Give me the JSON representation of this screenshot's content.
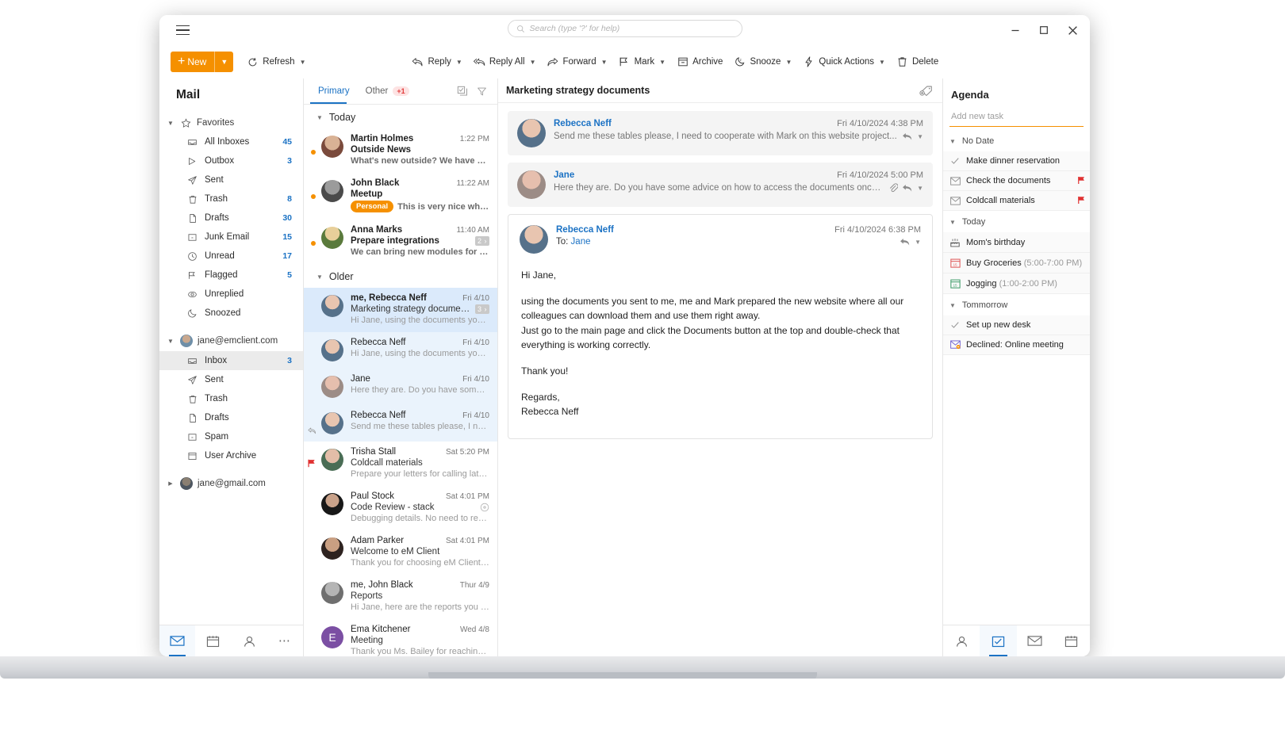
{
  "window": {
    "search_placeholder": "Search (type '?' for help)",
    "controls": {
      "minimize": "minimize-icon",
      "maximize": "maximize-icon",
      "close": "close-icon"
    },
    "menu_icon": "hamburger-icon"
  },
  "toolbar": {
    "new_label": "New",
    "refresh_label": "Refresh",
    "items": [
      {
        "label": "Reply",
        "icon": "reply-icon",
        "caret": true
      },
      {
        "label": "Reply All",
        "icon": "reply-all-icon",
        "caret": true
      },
      {
        "label": "Forward",
        "icon": "forward-icon",
        "caret": true
      },
      {
        "label": "Mark",
        "icon": "flag-icon",
        "caret": true
      },
      {
        "label": "Archive",
        "icon": "archive-icon",
        "caret": false
      },
      {
        "label": "Snooze",
        "icon": "snooze-icon",
        "caret": true
      },
      {
        "label": "Quick Actions",
        "icon": "lightning-icon",
        "caret": true
      },
      {
        "label": "Delete",
        "icon": "trash-icon",
        "caret": false
      }
    ]
  },
  "sidebar": {
    "title": "Mail",
    "favorites_label": "Favorites",
    "favorites": [
      {
        "label": "All Inboxes",
        "count": "45",
        "icon": "inbox-icon"
      },
      {
        "label": "Outbox",
        "count": "3",
        "icon": "outbox-icon"
      },
      {
        "label": "Sent",
        "count": "",
        "icon": "sent-icon"
      },
      {
        "label": "Trash",
        "count": "8",
        "icon": "trash-icon"
      },
      {
        "label": "Drafts",
        "count": "30",
        "icon": "drafts-icon"
      },
      {
        "label": "Junk Email",
        "count": "15",
        "icon": "junk-icon"
      },
      {
        "label": "Unread",
        "count": "17",
        "icon": "clock-icon"
      },
      {
        "label": "Flagged",
        "count": "5",
        "icon": "flag-icon"
      },
      {
        "label": "Unreplied",
        "count": "",
        "icon": "eye-icon"
      },
      {
        "label": "Snoozed",
        "count": "",
        "icon": "snooze-icon"
      }
    ],
    "account1": {
      "label": "jane@emclient.com",
      "expanded": true
    },
    "account1_folders": [
      {
        "label": "Inbox",
        "count": "3",
        "icon": "inbox-icon",
        "selected": true
      },
      {
        "label": "Sent",
        "count": "",
        "icon": "sent-icon",
        "selected": false
      },
      {
        "label": "Trash",
        "count": "",
        "icon": "trash-icon",
        "selected": false
      },
      {
        "label": "Drafts",
        "count": "",
        "icon": "drafts-icon",
        "selected": false
      },
      {
        "label": "Spam",
        "count": "",
        "icon": "junk-icon",
        "selected": false
      },
      {
        "label": "User Archive",
        "count": "",
        "icon": "archive-icon",
        "selected": false
      }
    ],
    "account2": {
      "label": "jane@gmail.com",
      "expanded": false
    },
    "bottom_nav": [
      {
        "icon": "mail-icon",
        "active": true
      },
      {
        "icon": "calendar-icon",
        "active": false
      },
      {
        "icon": "contacts-icon",
        "active": false
      },
      {
        "icon": "more-icon",
        "active": false
      }
    ]
  },
  "messagelist": {
    "tabs": [
      {
        "label": "Primary",
        "badge": "",
        "active": true
      },
      {
        "label": "Other",
        "badge": "+1",
        "active": false
      }
    ],
    "header_icons": [
      {
        "icon": "select-all-icon"
      },
      {
        "icon": "filter-icon"
      }
    ],
    "sections": [
      {
        "label": "Today",
        "messages": [
          {
            "from": "Martin Holmes",
            "time": "1:22 PM",
            "subject": "Outside News",
            "preview": "What's new outside? We have been...",
            "unread": true,
            "selected": false,
            "thread": false,
            "category": "",
            "count": "",
            "avatar_color": "#8d6e5a",
            "avatar_letter": "",
            "flagged": false,
            "replied": false,
            "attachment": false,
            "snoozed": false
          },
          {
            "from": "John Black",
            "time": "11:22 AM",
            "subject": "Meetup",
            "preview": "This is very nice when y...",
            "unread": true,
            "selected": false,
            "thread": false,
            "category": "Personal",
            "count": "",
            "avatar_color": "#6b6b6b",
            "avatar_letter": "",
            "flagged": false,
            "replied": false,
            "attachment": false,
            "snoozed": false
          },
          {
            "from": "Anna Marks",
            "time": "11:40 AM",
            "subject": "Prepare integrations",
            "preview": "We can bring new modules for you...",
            "unread": true,
            "selected": false,
            "thread": false,
            "category": "",
            "count": "2 ›",
            "avatar_color": "#b59a6a",
            "avatar_letter": "",
            "flagged": false,
            "replied": false,
            "attachment": false,
            "snoozed": false
          }
        ]
      },
      {
        "label": "Older",
        "messages": [
          {
            "from": "me, Rebecca Neff",
            "time": "Fri 4/10",
            "subject": "Marketing strategy documents",
            "preview": "Hi Jane, using the documents you se...",
            "unread": false,
            "selected": true,
            "thread": false,
            "category": "",
            "count": "3 ›",
            "avatar_color": "#7e6a78",
            "avatar_letter": "",
            "flagged": false,
            "replied": false,
            "attachment": false,
            "snoozed": false
          },
          {
            "from": "Rebecca Neff",
            "time": "Fri 4/10",
            "subject": "",
            "preview": "Hi Jane, using the documents you se...",
            "unread": false,
            "selected": false,
            "thread": true,
            "category": "",
            "count": "",
            "avatar_color": "#7e6a78",
            "avatar_letter": "",
            "flagged": false,
            "replied": false,
            "attachment": false,
            "snoozed": false
          },
          {
            "from": "Jane",
            "time": "Fri 4/10",
            "subject": "",
            "preview": "Here they are. Do you have some adv...",
            "unread": false,
            "selected": false,
            "thread": true,
            "category": "",
            "count": "",
            "avatar_color": "#9a7f74",
            "avatar_letter": "",
            "flagged": false,
            "replied": false,
            "attachment": false,
            "snoozed": false
          },
          {
            "from": "Rebecca Neff",
            "time": "Fri 4/10",
            "subject": "",
            "preview": "Send me these tables please, I need t...",
            "unread": false,
            "selected": false,
            "thread": true,
            "category": "",
            "count": "",
            "avatar_color": "#7e6a78",
            "avatar_letter": "",
            "flagged": false,
            "replied": true,
            "attachment": false,
            "snoozed": false
          },
          {
            "from": "Trisha Stall",
            "time": "Sat 5:20 PM",
            "subject": "Coldcall materials",
            "preview": "Prepare your letters for calling later t...",
            "unread": false,
            "selected": false,
            "thread": false,
            "category": "",
            "count": "",
            "avatar_color": "#6f8a6f",
            "avatar_letter": "",
            "flagged": true,
            "replied": false,
            "attachment": false,
            "snoozed": false
          },
          {
            "from": "Paul Stock",
            "time": "Sat 4:01 PM",
            "subject": "Code Review - stack",
            "preview": "Debugging details. No need to reply.",
            "unread": false,
            "selected": false,
            "thread": false,
            "category": "",
            "count": "",
            "avatar_color": "#3d3a38",
            "avatar_letter": "",
            "flagged": false,
            "replied": false,
            "attachment": false,
            "snoozed": true
          },
          {
            "from": "Adam Parker",
            "time": "Sat 4:01 PM",
            "subject": "Welcome to eM Client",
            "preview": "Thank you for choosing eM Client. It...",
            "unread": false,
            "selected": false,
            "thread": false,
            "category": "",
            "count": "",
            "avatar_color": "#4a3b2f",
            "avatar_letter": "",
            "flagged": false,
            "replied": false,
            "attachment": false,
            "snoozed": false
          },
          {
            "from": "me, John Black",
            "time": "Thur 4/9",
            "subject": "Reports",
            "preview": "Hi Jane, here are the reports you ask...",
            "unread": false,
            "selected": false,
            "thread": false,
            "category": "",
            "count": "",
            "avatar_color": "#8d8d8d",
            "avatar_letter": "",
            "flagged": false,
            "replied": false,
            "attachment": false,
            "snoozed": false
          },
          {
            "from": "Ema Kitchener",
            "time": "Wed 4/8",
            "subject": "Meeting",
            "preview": "Thank you Ms. Bailey for reaching ou...",
            "unread": false,
            "selected": false,
            "thread": false,
            "category": "",
            "count": "",
            "avatar_color": "#7b4fa3",
            "avatar_letter": "E",
            "flagged": false,
            "replied": false,
            "attachment": false,
            "snoozed": false
          }
        ]
      }
    ]
  },
  "reader": {
    "title": "Marketing strategy documents",
    "tag_icon": "add-tag-icon",
    "collapsed": [
      {
        "name": "Rebecca Neff",
        "date": "Fri 4/10/2024 4:38 PM",
        "preview": "Send me these tables please, I need to cooperate with Mark on this website project...",
        "attachment": false,
        "avatar_color": "#7e6a78"
      },
      {
        "name": "Jane",
        "date": "Fri 4/10/2024 5:00 PM",
        "preview": "Here they are. Do you have some advice on how to access the documents once th...",
        "attachment": true,
        "avatar_color": "#9a7f74"
      }
    ],
    "open": {
      "name": "Rebecca Neff",
      "date": "Fri 4/10/2024 6:38 PM",
      "to_label": "To:",
      "to_name": "Jane",
      "avatar_color": "#7e6a78",
      "paragraphs": [
        "Hi Jane,",
        "using the documents you sent to me, me and Mark prepared the new website where all our colleagues can download them and use them right away.\nJust go to the main page and click the Documents button at the top and double-check that everything is working correctly.",
        "Thank you!",
        "Regards,\nRebecca Neff"
      ]
    }
  },
  "agenda": {
    "title": "Agenda",
    "add_task_placeholder": "Add new task",
    "groups": [
      {
        "label": "No Date",
        "items": [
          {
            "text": "Make dinner reservation",
            "time": "",
            "icon": "check-icon",
            "flagged": false
          },
          {
            "text": "Check the documents",
            "time": "",
            "icon": "mail-task-icon",
            "flagged": true
          },
          {
            "text": "Coldcall materials",
            "time": "",
            "icon": "mail-task-icon",
            "flagged": true
          }
        ]
      },
      {
        "label": "Today",
        "items": [
          {
            "text": "Mom's birthday",
            "time": "",
            "icon": "birthday-icon",
            "flagged": false
          },
          {
            "text": "Buy Groceries",
            "time": "(5:00-7:00 PM)",
            "icon": "calendar-red-icon",
            "flagged": false
          },
          {
            "text": "Jogging",
            "time": "(1:00-2:00 PM)",
            "icon": "calendar-green-icon",
            "flagged": false
          }
        ]
      },
      {
        "label": "Tommorrow",
        "items": [
          {
            "text": "Set up new desk",
            "time": "",
            "icon": "check-icon",
            "flagged": false
          },
          {
            "text": "Declined: Online meeting",
            "time": "",
            "icon": "declined-icon",
            "flagged": false
          }
        ]
      }
    ],
    "bottom_nav": [
      {
        "icon": "contacts-icon",
        "active": false
      },
      {
        "icon": "agenda-icon",
        "active": true
      },
      {
        "icon": "mail-icon",
        "active": false
      },
      {
        "icon": "calendar-icon",
        "active": false
      }
    ]
  },
  "colors": {
    "accent_orange": "#F59000",
    "accent_blue": "#1b72c4",
    "flag_red": "#e03131",
    "selected_blue": "#dbeafb"
  }
}
